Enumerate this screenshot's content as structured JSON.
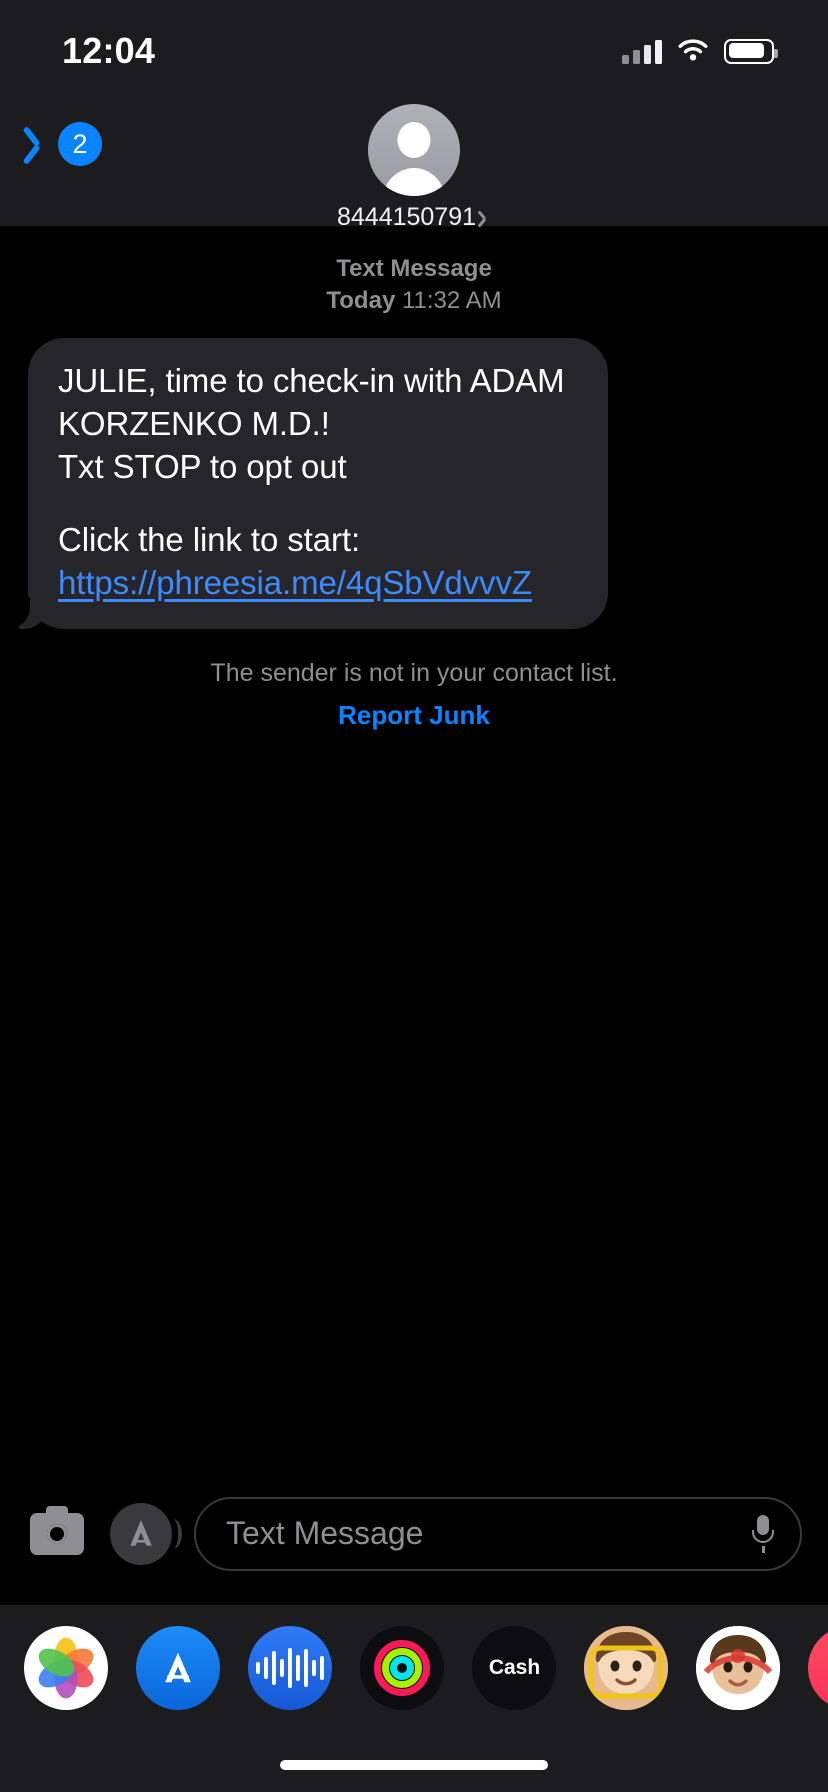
{
  "status_bar": {
    "time": "12:04",
    "cellular_icon": "cellular-signal-icon",
    "wifi_icon": "wifi-icon",
    "battery_icon": "battery-icon"
  },
  "nav_bar": {
    "back_icon": "chevron-left-icon",
    "unread_count": "2",
    "avatar_icon": "person-placeholder-avatar",
    "contact_name": "8444150791",
    "detail_chevron_icon": "chevron-right-icon"
  },
  "conversation": {
    "message_kind": "Text Message",
    "date_label": "Today",
    "time_label": "11:32 AM",
    "bubble": {
      "line1": "JULIE, time to check-in with ADAM KORZENKO M.D.!",
      "line2": "Txt STOP to opt out",
      "line3": "Click the link to start:",
      "link_text": "https://phreesia.me/4qSbVdvvvZ",
      "bubble_color": "#26262a",
      "link_color": "#3d8bff"
    },
    "junk_note": "The sender is not in your contact list.",
    "report_junk_label": "Report Junk",
    "report_junk_color": "#0a84ff"
  },
  "input_bar": {
    "camera_icon": "camera-icon",
    "apps_icon": "app-store-icon",
    "placeholder": "Text Message",
    "mic_icon": "microphone-icon"
  },
  "app_drawer": {
    "items": [
      {
        "name": "photos-app-icon",
        "label": "Photos"
      },
      {
        "name": "app-store-app-icon",
        "label": "App Store"
      },
      {
        "name": "voice-memos-app-icon",
        "label": "Voice Memos"
      },
      {
        "name": "fitness-app-icon",
        "label": "Fitness"
      },
      {
        "name": "apple-cash-app-icon",
        "label": "Apple Cash",
        "apple_mark": "",
        "text": "Cash"
      },
      {
        "name": "memoji-sticker-icon-1",
        "label": "Memoji"
      },
      {
        "name": "memoji-sticker-icon-2",
        "label": "Memoji"
      },
      {
        "name": "music-app-icon",
        "label": "Music",
        "glyph": "♫"
      }
    ]
  },
  "home_indicator": "home-indicator"
}
